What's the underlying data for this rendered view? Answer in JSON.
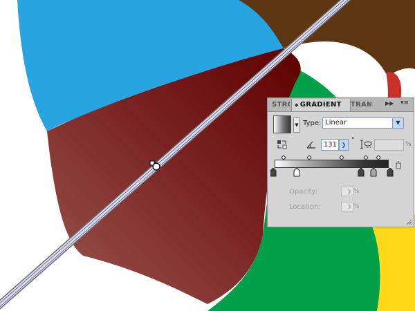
{
  "artwork": {
    "colors": {
      "sky": "#28a5e0",
      "brown": "#5d3713",
      "green": "#009f48",
      "yellow": "#ffd817",
      "red": "#c8312a",
      "gradient_dark": "#640000",
      "gradient_light": "#9a5750"
    }
  },
  "gradient_panel": {
    "tabs": {
      "stroke": "STRO",
      "gradient": "GRADIENT",
      "transparency": "TRAN"
    },
    "collapse_icon": "double-chevron-right",
    "menu_icon": "panel-menu",
    "type_label": "Type:",
    "type_value": "Linear",
    "angle_value": "131",
    "degree_symbol": "°",
    "aspect_unit": "%",
    "opacity_label": "Opacity:",
    "opacity_unit": "%",
    "location_label": "Location:",
    "location_unit": "%"
  }
}
